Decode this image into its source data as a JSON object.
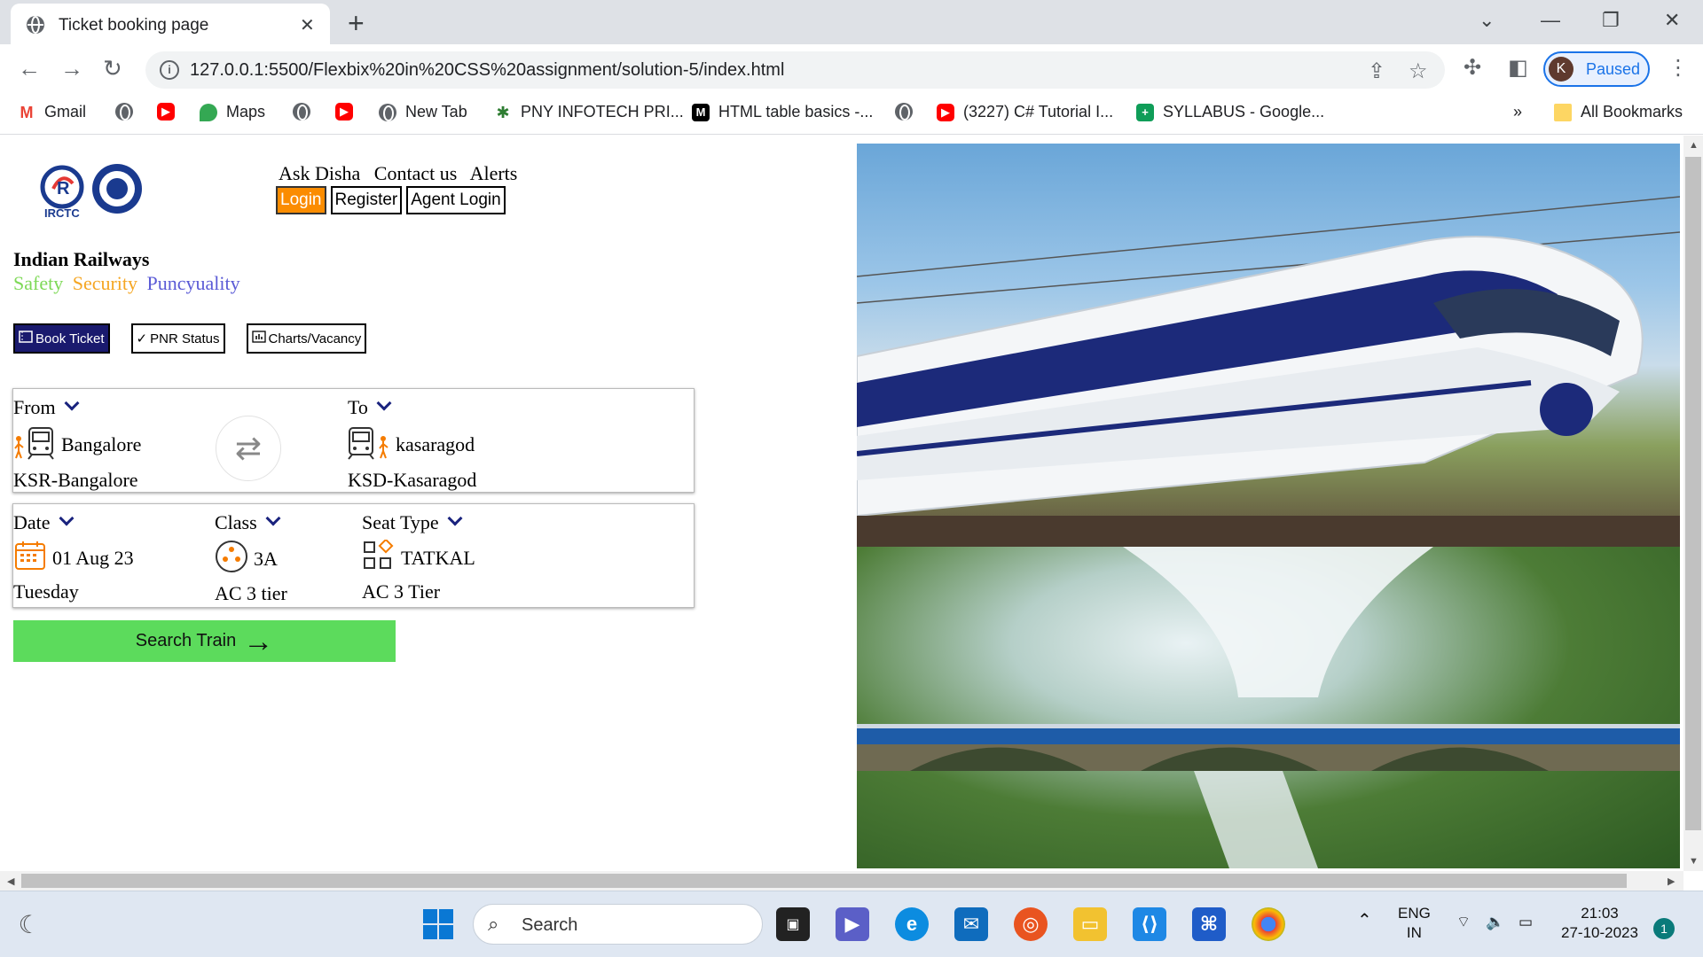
{
  "browser": {
    "tab_title": "Ticket booking page",
    "url": "127.0.0.1:5500/Flexbix%20in%20CSS%20assignment/solution-5/index.html",
    "profile_initial": "K",
    "profile_status": "Paused",
    "bookmarks": [
      {
        "label": "Gmail",
        "icon": "gmail-icon"
      },
      {
        "label": "",
        "icon": "globe-icon"
      },
      {
        "label": "",
        "icon": "youtube-icon"
      },
      {
        "label": "Maps",
        "icon": "maps-icon"
      },
      {
        "label": "",
        "icon": "globe-icon"
      },
      {
        "label": "",
        "icon": "youtube-icon"
      },
      {
        "label": "New Tab",
        "icon": "globe-icon"
      },
      {
        "label": "PNY INFOTECH PRI...",
        "icon": "pny-icon"
      },
      {
        "label": "HTML table basics -...",
        "icon": "mdn-icon"
      },
      {
        "label": "",
        "icon": "globe-icon"
      },
      {
        "label": "(3227) C# Tutorial I...",
        "icon": "youtube-icon"
      },
      {
        "label": "SYLLABUS - Google...",
        "icon": "sheets-icon"
      }
    ],
    "overflow_label": "»",
    "all_bookmarks": "All Bookmarks"
  },
  "page": {
    "logo_text": "IRCTC",
    "topnav": [
      "Ask Disha",
      "Contact us",
      "Alerts"
    ],
    "auth": {
      "login": "Login",
      "register": "Register",
      "agent_login": "Agent Login"
    },
    "brand_title": "Indian Railways",
    "tagline": [
      {
        "text": "Safety",
        "color": "#7ed957"
      },
      {
        "text": "Security",
        "color": "#f5a623"
      },
      {
        "text": "Puncyuality",
        "color": "#5b5bd6"
      }
    ],
    "modes": [
      "Book Ticket",
      "PNR Status",
      "Charts/Vacancy"
    ],
    "from": {
      "label": "From",
      "value": "Bangalore",
      "sub": "KSR-Bangalore"
    },
    "to": {
      "label": "To",
      "value": "kasaragod",
      "sub": "KSD-Kasaragod"
    },
    "date": {
      "label": "Date",
      "value": "01 Aug 23",
      "sub": "Tuesday"
    },
    "class": {
      "label": "Class",
      "value": "3A",
      "sub": "AC 3 tier"
    },
    "seat": {
      "label": "Seat Type",
      "value": "TATKAL",
      "sub": "AC 3 Tier"
    },
    "search_button": "Search Train",
    "accent_green": "#5cdb5c",
    "accent_orange": "#fb8c00"
  },
  "taskbar": {
    "search_placeholder": "Search",
    "lang_line1": "ENG",
    "lang_line2": "IN",
    "time": "21:03",
    "date": "27-10-2023",
    "notification_count": "1"
  }
}
